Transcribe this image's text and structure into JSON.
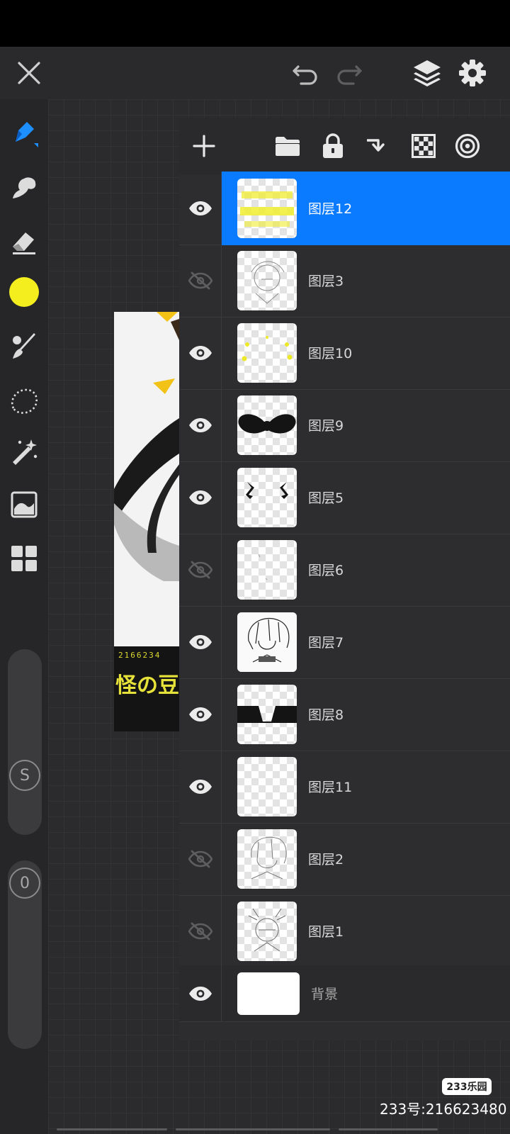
{
  "topbar": {
    "close_icon": "close-icon",
    "undo_icon": "undo-icon",
    "redo_icon": "redo-icon",
    "layers_icon": "layers-icon",
    "settings_icon": "gear-icon"
  },
  "toolbar": {
    "tools": [
      "pencil-icon",
      "smudge-icon",
      "eraser-icon",
      "color-swatch",
      "brush-icon",
      "lasso-icon",
      "magic-wand-icon",
      "adjust-icon",
      "grid-icon"
    ],
    "current_color": "#f5ee1e",
    "size_slider_label": "S",
    "opacity_slider_label": "0"
  },
  "layers_header": {
    "buttons": [
      "add-layer-icon",
      "folder-icon",
      "lock-icon",
      "merge-down-icon",
      "transparency-icon",
      "target-icon"
    ]
  },
  "layers": [
    {
      "name": "图层12",
      "visible": true,
      "selected": true
    },
    {
      "name": "图层3",
      "visible": false,
      "selected": false
    },
    {
      "name": "图层10",
      "visible": true,
      "selected": false
    },
    {
      "name": "图层9",
      "visible": true,
      "selected": false
    },
    {
      "name": "图层5",
      "visible": true,
      "selected": false
    },
    {
      "name": "图层6",
      "visible": false,
      "selected": false
    },
    {
      "name": "图层7",
      "visible": true,
      "selected": false
    },
    {
      "name": "图层8",
      "visible": true,
      "selected": false
    },
    {
      "name": "图层11",
      "visible": true,
      "selected": false
    },
    {
      "name": "图层2",
      "visible": false,
      "selected": false
    },
    {
      "name": "图层1",
      "visible": false,
      "selected": false
    },
    {
      "name": "背景",
      "visible": true,
      "selected": false
    }
  ],
  "artwork": {
    "signature_number": "2166234",
    "signature_text": "怪の豆"
  },
  "watermark": {
    "badge": "233乐园",
    "text": "233号:216623480"
  },
  "colors": {
    "accent": "#0a7aff",
    "panel": "#2d2d30",
    "toolbar": "#262628"
  }
}
